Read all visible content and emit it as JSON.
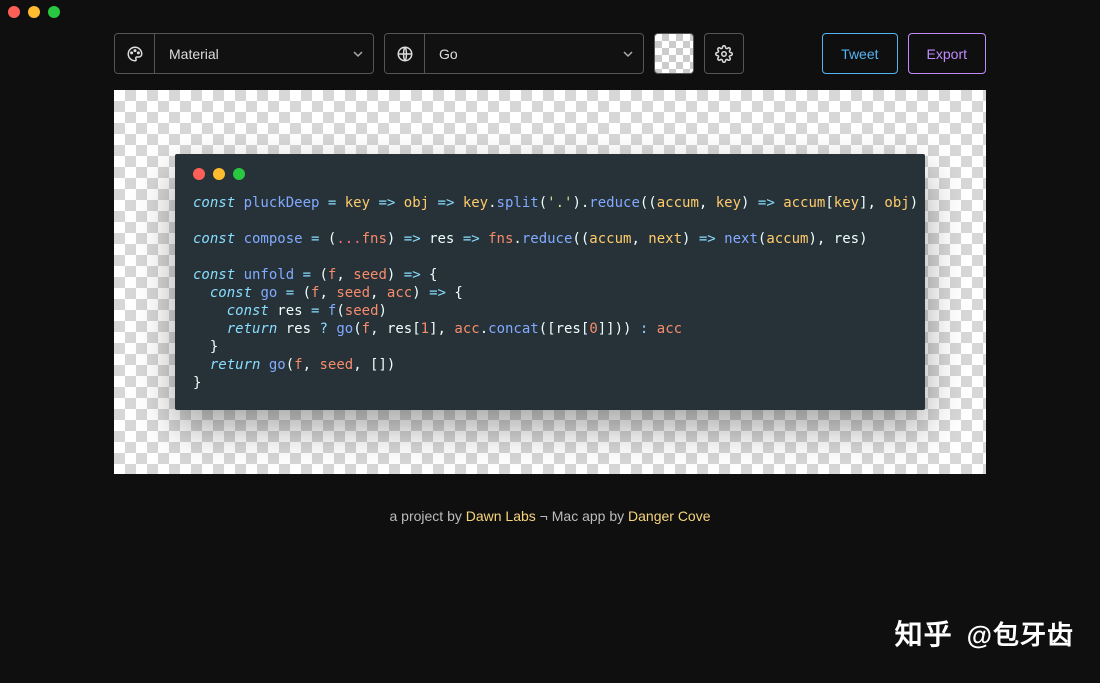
{
  "window": {
    "controls": [
      "close",
      "minimize",
      "zoom"
    ]
  },
  "toolbar": {
    "theme_select": {
      "value": "Material",
      "icon": "palette"
    },
    "language_select": {
      "value": "Go",
      "icon": "globe"
    },
    "bg_picker_tooltip": "Background",
    "settings_tooltip": "Settings",
    "tweet_label": "Tweet",
    "export_label": "Export"
  },
  "card": {
    "controls": [
      "close",
      "minimize",
      "zoom"
    ]
  },
  "code": {
    "tokens": [
      [
        [
          "kw",
          "const "
        ],
        [
          "fn",
          "pluckDeep"
        ],
        [
          "pn",
          " "
        ],
        [
          "op",
          "="
        ],
        [
          "pn",
          " "
        ],
        [
          "p-a",
          "key"
        ],
        [
          "pn",
          " "
        ],
        [
          "op",
          "=>"
        ],
        [
          "pn",
          " "
        ],
        [
          "p-a",
          "obj"
        ],
        [
          "pn",
          " "
        ],
        [
          "op",
          "=>"
        ],
        [
          "pn",
          " "
        ],
        [
          "p-a",
          "key"
        ],
        [
          "pn",
          "."
        ],
        [
          "fn2",
          "split"
        ],
        [
          "pn",
          "("
        ],
        [
          "str",
          "'.'"
        ],
        [
          "pn",
          ")."
        ],
        [
          "fn2",
          "reduce"
        ],
        [
          "pn",
          "(("
        ],
        [
          "p-a",
          "accum"
        ],
        [
          "pn",
          ", "
        ],
        [
          "p-a",
          "key"
        ],
        [
          "pn",
          ") "
        ],
        [
          "op",
          "=>"
        ],
        [
          "pn",
          " "
        ],
        [
          "p-a",
          "accum"
        ],
        [
          "pn",
          "["
        ],
        [
          "p-a",
          "key"
        ],
        [
          "pn",
          "], "
        ],
        [
          "p-a",
          "obj"
        ],
        [
          "pn",
          ")"
        ]
      ],
      [],
      [
        [
          "kw",
          "const "
        ],
        [
          "fn",
          "compose"
        ],
        [
          "pn",
          " "
        ],
        [
          "op",
          "="
        ],
        [
          "pn",
          " ("
        ],
        [
          "spr",
          "..."
        ],
        [
          "prm",
          "fns"
        ],
        [
          "pn",
          ") "
        ],
        [
          "op",
          "=>"
        ],
        [
          "pn",
          " "
        ],
        [
          "id",
          "res"
        ],
        [
          "pn",
          " "
        ],
        [
          "op",
          "=>"
        ],
        [
          "pn",
          " "
        ],
        [
          "prm",
          "fns"
        ],
        [
          "pn",
          "."
        ],
        [
          "fn2",
          "reduce"
        ],
        [
          "pn",
          "(("
        ],
        [
          "p-a",
          "accum"
        ],
        [
          "pn",
          ", "
        ],
        [
          "p-a",
          "next"
        ],
        [
          "pn",
          ") "
        ],
        [
          "op",
          "=>"
        ],
        [
          "pn",
          " "
        ],
        [
          "fn2",
          "next"
        ],
        [
          "pn",
          "("
        ],
        [
          "p-a",
          "accum"
        ],
        [
          "pn",
          "), "
        ],
        [
          "id",
          "res"
        ],
        [
          "pn",
          ")"
        ]
      ],
      [],
      [
        [
          "kw",
          "const "
        ],
        [
          "fn",
          "unfold"
        ],
        [
          "pn",
          " "
        ],
        [
          "op",
          "="
        ],
        [
          "pn",
          " ("
        ],
        [
          "prm",
          "f"
        ],
        [
          "pn",
          ", "
        ],
        [
          "prm",
          "seed"
        ],
        [
          "pn",
          ") "
        ],
        [
          "op",
          "=>"
        ],
        [
          "pn",
          " {"
        ]
      ],
      [
        [
          "pn",
          "  "
        ],
        [
          "kw",
          "const "
        ],
        [
          "fn",
          "go"
        ],
        [
          "pn",
          " "
        ],
        [
          "op",
          "="
        ],
        [
          "pn",
          " ("
        ],
        [
          "prm",
          "f"
        ],
        [
          "pn",
          ", "
        ],
        [
          "prm",
          "seed"
        ],
        [
          "pn",
          ", "
        ],
        [
          "prm",
          "acc"
        ],
        [
          "pn",
          ") "
        ],
        [
          "op",
          "=>"
        ],
        [
          "pn",
          " {"
        ]
      ],
      [
        [
          "pn",
          "    "
        ],
        [
          "kw",
          "const "
        ],
        [
          "id",
          "res"
        ],
        [
          "pn",
          " "
        ],
        [
          "op",
          "="
        ],
        [
          "pn",
          " "
        ],
        [
          "fn",
          "f"
        ],
        [
          "pn",
          "("
        ],
        [
          "prm",
          "seed"
        ],
        [
          "pn",
          ")"
        ]
      ],
      [
        [
          "pn",
          "    "
        ],
        [
          "kw",
          "return "
        ],
        [
          "id",
          "res"
        ],
        [
          "pn",
          " "
        ],
        [
          "op",
          "?"
        ],
        [
          "pn",
          " "
        ],
        [
          "fn",
          "go"
        ],
        [
          "pn",
          "("
        ],
        [
          "prm",
          "f"
        ],
        [
          "pn",
          ", "
        ],
        [
          "id",
          "res"
        ],
        [
          "pn",
          "["
        ],
        [
          "num",
          "1"
        ],
        [
          "pn",
          "], "
        ],
        [
          "prm",
          "acc"
        ],
        [
          "pn",
          "."
        ],
        [
          "fn2",
          "concat"
        ],
        [
          "pn",
          "(["
        ],
        [
          "id",
          "res"
        ],
        [
          "pn",
          "["
        ],
        [
          "num",
          "0"
        ],
        [
          "pn",
          "]])) "
        ],
        [
          "op",
          ":"
        ],
        [
          "pn",
          " "
        ],
        [
          "prm",
          "acc"
        ]
      ],
      [
        [
          "pn",
          "  }"
        ]
      ],
      [
        [
          "pn",
          "  "
        ],
        [
          "kw",
          "return "
        ],
        [
          "fn",
          "go"
        ],
        [
          "pn",
          "("
        ],
        [
          "prm",
          "f"
        ],
        [
          "pn",
          ", "
        ],
        [
          "prm",
          "seed"
        ],
        [
          "pn",
          ", [])"
        ]
      ],
      [
        [
          "pn",
          "}"
        ]
      ]
    ]
  },
  "footer": {
    "prefix": "a project by ",
    "link1": "Dawn Labs",
    "middle": " ¬ Mac app by ",
    "link2": "Danger Cove"
  },
  "watermark": {
    "logo": "知乎",
    "handle": "@包牙齿"
  },
  "colors": {
    "tweet": "#56b3f1",
    "export": "#c18cff",
    "card_bg": "#263238"
  }
}
